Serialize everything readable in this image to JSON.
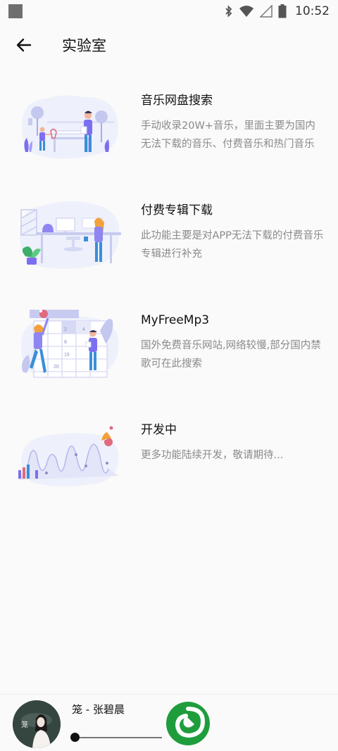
{
  "status_bar": {
    "time": "10:52",
    "icons": [
      "notification-square-icon",
      "bluetooth-icon",
      "wifi-icon",
      "signal-icon",
      "battery-icon"
    ]
  },
  "header": {
    "back_icon": "arrow-left-icon",
    "title": "实验室"
  },
  "features": [
    {
      "title": "音乐网盘搜索",
      "desc": "手动收录20W+音乐，里面主要为国内无法下载的音乐、付费音乐和热门音乐"
    },
    {
      "title": "付费专辑下载",
      "desc": "此功能主要是对APP无法下载的付费音乐专辑进行补充"
    },
    {
      "title": "MyFreeMp3",
      "desc": "国外免费音乐网站,网络较慢,部分国内禁歌可在此搜索"
    },
    {
      "title": "开发中",
      "desc": "更多功能陆续开发，敬请期待..."
    }
  ],
  "calendar_numbers": [
    "4",
    "2",
    "8",
    "15",
    "20"
  ],
  "player": {
    "song": "笼 - 张碧晨",
    "progress": 0,
    "cover_text": "笼"
  },
  "colors": {
    "accent": "#1f9d3d",
    "illustration_purple": "#7b6ff0",
    "illustration_blue": "#3a8ed9"
  }
}
